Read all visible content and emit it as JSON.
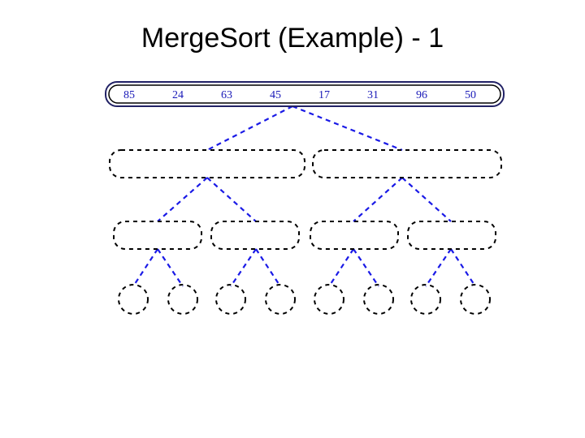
{
  "title": "MergeSort (Example) - 1",
  "root_values": [
    "85",
    "24",
    "63",
    "45",
    "17",
    "31",
    "96",
    "50"
  ],
  "chart_data": {
    "type": "tree",
    "title": "MergeSort (Example) - 1",
    "levels": [
      {
        "nodes": 1,
        "filled": true,
        "values": [
          [
            85,
            24,
            63,
            45,
            17,
            31,
            96,
            50
          ]
        ]
      },
      {
        "nodes": 2,
        "filled": false
      },
      {
        "nodes": 4,
        "filled": false
      },
      {
        "nodes": 8,
        "filled": false
      }
    ]
  }
}
